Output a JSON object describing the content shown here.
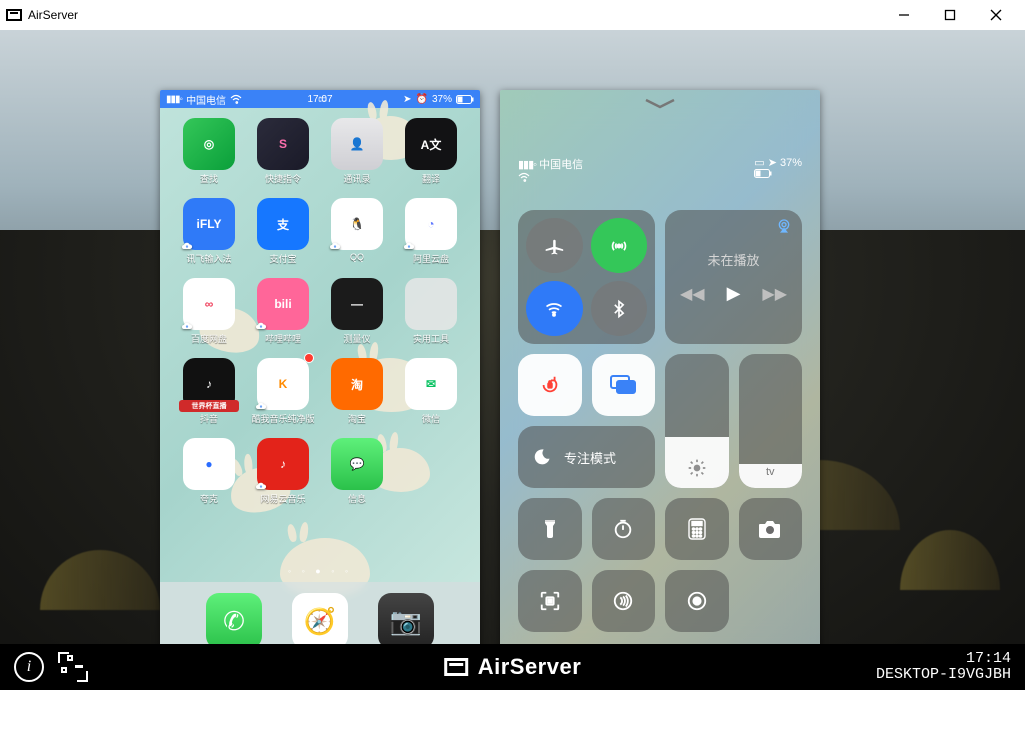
{
  "window": {
    "title": "AirServer"
  },
  "footer": {
    "product": "AirServer",
    "time": "17:14",
    "host": "DESKTOP-I9VGJBH"
  },
  "phone1": {
    "status": {
      "carrier": "中国电信",
      "time": "17:07",
      "battery": "37%"
    },
    "apps": [
      {
        "name": "查找",
        "bg": "linear-gradient(135deg,#34c759,#0a9f3a)",
        "glyph": "◎",
        "cloud": false
      },
      {
        "name": "快捷指令",
        "bg": "linear-gradient(135deg,#2b2b3b,#1a1a28)",
        "glyph": "S",
        "fg": "#ff6fae",
        "cloud": false
      },
      {
        "name": "通讯录",
        "bg": "linear-gradient(#e8e8ea,#cfcfd4)",
        "glyph": "👤",
        "fg": "#888",
        "cloud": false
      },
      {
        "name": "翻译",
        "bg": "#121214",
        "glyph": "A文",
        "cloud": false
      },
      {
        "name": "讯飞输入法",
        "bg": "#2f7af8",
        "glyph": "iFLY",
        "cloud": true
      },
      {
        "name": "支付宝",
        "bg": "#1677ff",
        "glyph": "支",
        "cloud": false
      },
      {
        "name": "QQ",
        "bg": "#ffffff",
        "glyph": "🐧",
        "fg": "#000",
        "cloud": true
      },
      {
        "name": "阿里云盘",
        "bg": "#ffffff",
        "glyph": "◔",
        "fg": "#637bff",
        "cloud": true
      },
      {
        "name": "百度网盘",
        "bg": "#ffffff",
        "glyph": "∞",
        "fg": "#ef3e5b",
        "cloud": true
      },
      {
        "name": "哔哩哔哩",
        "bg": "#ff6699",
        "glyph": "bili",
        "cloud": true
      },
      {
        "name": "测量仪",
        "bg": "#1b1b1b",
        "glyph": "—",
        "cloud": false
      },
      {
        "name": "实用工具",
        "bg": "rgba(230,230,230,.85)",
        "folder": true,
        "glyph": "",
        "cloud": false
      },
      {
        "name": "抖音",
        "bg": "#111111",
        "glyph": "♪",
        "badge": "世界杯直播",
        "cloud": true
      },
      {
        "name": "酷我音乐纯净版",
        "bg": "#ffffff",
        "glyph": "K",
        "fg": "#ff8a00",
        "cloud": true,
        "dot": true
      },
      {
        "name": "淘宝",
        "bg": "#ff6a00",
        "glyph": "淘",
        "cloud": false
      },
      {
        "name": "微信",
        "bg": "#ffffff",
        "glyph": "✉",
        "fg": "#07c160",
        "cloud": false
      },
      {
        "name": "夸克",
        "bg": "#ffffff",
        "glyph": "●",
        "fg": "#2a6cff",
        "cloud": false
      },
      {
        "name": "网易云音乐",
        "bg": "#e3231a",
        "glyph": "♪",
        "cloud": true
      },
      {
        "name": "信息",
        "bg": "linear-gradient(#5ef07a,#2bc14a)",
        "glyph": "💬",
        "cloud": false
      }
    ],
    "dock": [
      {
        "name": "电话",
        "bg": "linear-gradient(#5ef07a,#2bc14a)",
        "glyph": "✆"
      },
      {
        "name": "Safari",
        "bg": "#ffffff",
        "glyph": "🧭",
        "fg": "#2a6cff"
      },
      {
        "name": "相机",
        "bg": "linear-gradient(#444,#222)",
        "glyph": "📷"
      }
    ]
  },
  "phone2": {
    "status": {
      "carrier": "中国电信",
      "battery": "37%"
    },
    "nowplaying": "未在播放",
    "focus": "专注模式",
    "brightness_pct": 38,
    "volume_pct": 18,
    "volume_glyph": "tv"
  }
}
